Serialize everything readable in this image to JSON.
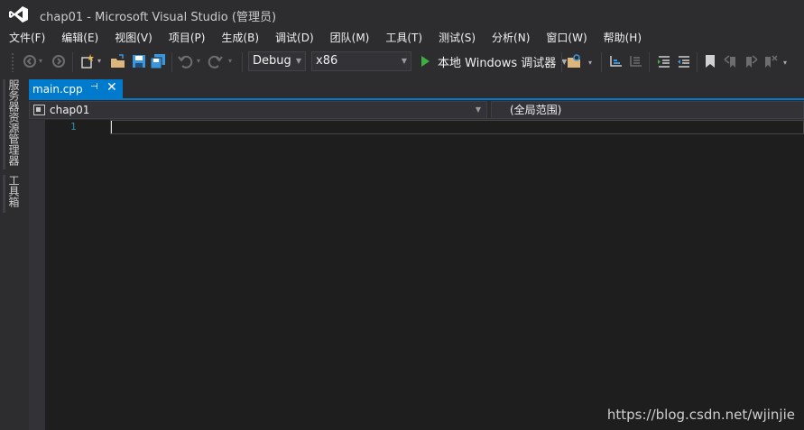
{
  "window": {
    "title": "chap01 - Microsoft Visual Studio (管理员)"
  },
  "menu": [
    "文件(F)",
    "编辑(E)",
    "视图(V)",
    "项目(P)",
    "生成(B)",
    "调试(D)",
    "团队(M)",
    "工具(T)",
    "测试(S)",
    "分析(N)",
    "窗口(W)",
    "帮助(H)"
  ],
  "toolbar": {
    "configuration": "Debug",
    "platform": "x86",
    "run_label": "本地 Windows 调试器",
    "icons": [
      "back-icon",
      "forward-icon",
      "new-project-icon",
      "open-file-icon",
      "save-icon",
      "save-all-icon",
      "undo-icon",
      "redo-icon",
      "play-icon",
      "find-in-files-icon",
      "comment-icon",
      "uncomment-icon",
      "indent-icon",
      "outdent-icon",
      "bookmark-icon",
      "prev-bookmark-icon",
      "next-bookmark-icon",
      "clear-bookmarks-icon"
    ]
  },
  "left_dock": {
    "tabs": [
      "服务器资源管理器",
      "工具箱"
    ]
  },
  "editor": {
    "tab_label": "main.cpp",
    "nav_project": "chap01",
    "nav_scope": "(全局范围)",
    "line_numbers": [
      "1"
    ]
  },
  "watermark": "https://blog.csdn.net/wjinjie",
  "colors": {
    "accent": "#007acc",
    "background": "#2d2d30",
    "editor_bg": "#1e1e1e",
    "line_number": "#2b91af",
    "run_green": "#3eaf3e"
  }
}
